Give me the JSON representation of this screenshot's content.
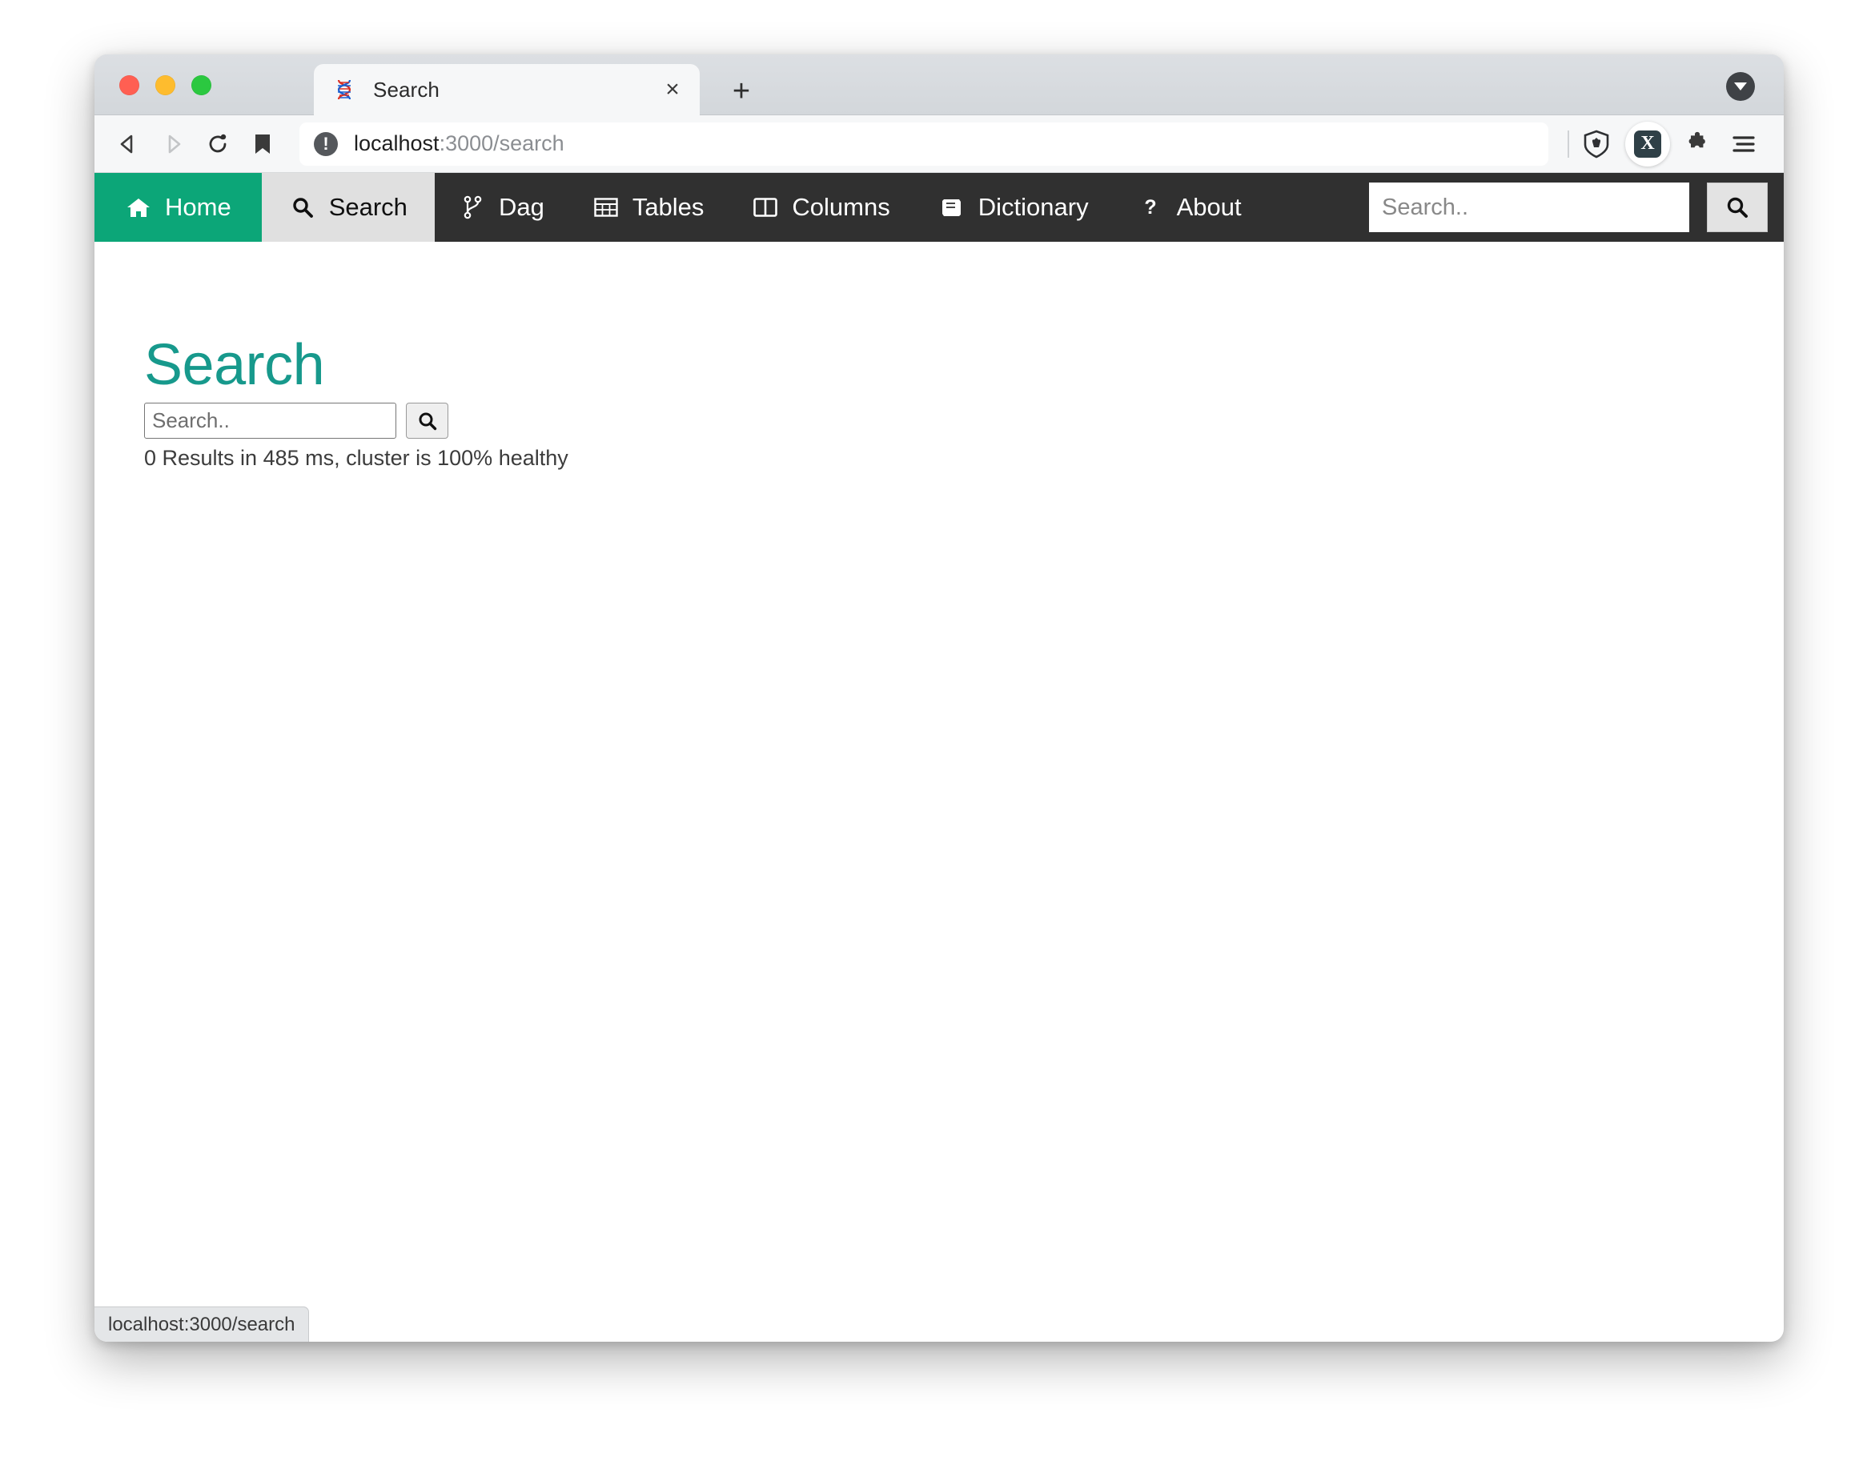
{
  "window": {
    "traffic_lights": [
      "close",
      "minimize",
      "zoom"
    ],
    "colors": {
      "close": "#ff5f52",
      "minimize": "#febc2e",
      "zoom": "#2bc840",
      "brand_green": "#0ca678",
      "heading_teal": "#17998c",
      "navbar_dark": "#303030",
      "active_tab_bg": "#e0e0e0"
    }
  },
  "browser": {
    "tab": {
      "favicon": "dna-helix-icon",
      "title": "Search",
      "close_label": "×"
    },
    "new_tab_label": "+",
    "tab_list_icon": "chevron-down-icon",
    "toolbar": {
      "back_icon": "back-arrow-icon",
      "forward_icon": "forward-arrow-icon",
      "reload_icon": "reload-icon",
      "bookmark_icon": "bookmark-icon",
      "site_info_icon": "info-icon",
      "url_host": "localhost",
      "url_path": ":3000/search",
      "shield_icon": "brave-shield-icon",
      "extension_badge_label": "X",
      "puzzle_icon": "puzzle-piece-icon",
      "menu_icon": "hamburger-menu-icon"
    },
    "status_bar": {
      "url": "localhost:3000/search"
    }
  },
  "app": {
    "navbar": {
      "items": [
        {
          "label": "Home",
          "icon": "home-icon",
          "state": "brand"
        },
        {
          "label": "Search",
          "icon": "search-icon",
          "state": "active"
        },
        {
          "label": "Dag",
          "icon": "code-branch-icon",
          "state": "default"
        },
        {
          "label": "Tables",
          "icon": "table-icon",
          "state": "default"
        },
        {
          "label": "Columns",
          "icon": "columns-icon",
          "state": "default"
        },
        {
          "label": "Dictionary",
          "icon": "book-icon",
          "state": "default"
        },
        {
          "label": "About",
          "icon": "question-icon",
          "state": "default"
        }
      ],
      "search": {
        "value": "",
        "placeholder": "Search..",
        "button_icon": "search-icon"
      }
    },
    "main": {
      "title": "Search",
      "search": {
        "value": "",
        "placeholder": "Search..",
        "button_icon": "search-icon"
      },
      "results_status": "0 Results in 485 ms, cluster is 100% healthy",
      "results_count": 0,
      "elapsed_ms": 485,
      "cluster_health_percent": 100
    }
  }
}
